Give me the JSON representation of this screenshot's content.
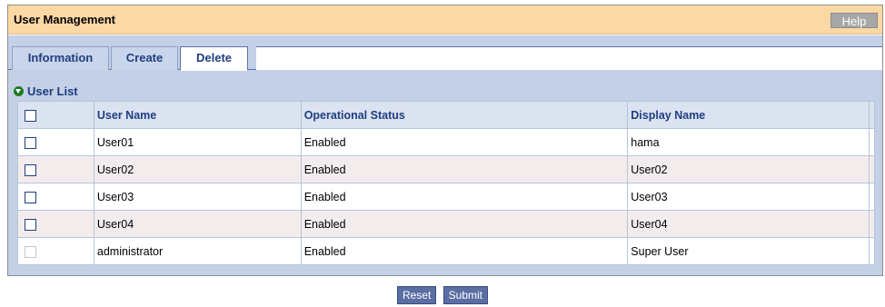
{
  "header": {
    "title": "User Management",
    "help_label": "Help"
  },
  "tabs": [
    {
      "label": "Information",
      "active": false
    },
    {
      "label": "Create",
      "active": false
    },
    {
      "label": "Delete",
      "active": true
    }
  ],
  "section": {
    "label": "User List"
  },
  "table": {
    "columns": [
      "User Name",
      "Operational Status",
      "Display Name"
    ],
    "rows": [
      {
        "user": "User01",
        "status": "Enabled",
        "display": "hama",
        "checkable": true
      },
      {
        "user": "User02",
        "status": "Enabled",
        "display": "User02",
        "checkable": true
      },
      {
        "user": "User03",
        "status": "Enabled",
        "display": "User03",
        "checkable": true
      },
      {
        "user": "User04",
        "status": "Enabled",
        "display": "User04",
        "checkable": true
      },
      {
        "user": "administrator",
        "status": "Enabled",
        "display": "Super User",
        "checkable": false
      }
    ]
  },
  "actions": {
    "reset_label": "Reset",
    "submit_label": "Submit"
  },
  "colors": {
    "title_bg": "#fbd8a4",
    "panel_bg": "#c3d0e6",
    "header_text": "#1f3d80",
    "alt_row": "#f3eced",
    "button_bg": "#5a6ea3"
  }
}
